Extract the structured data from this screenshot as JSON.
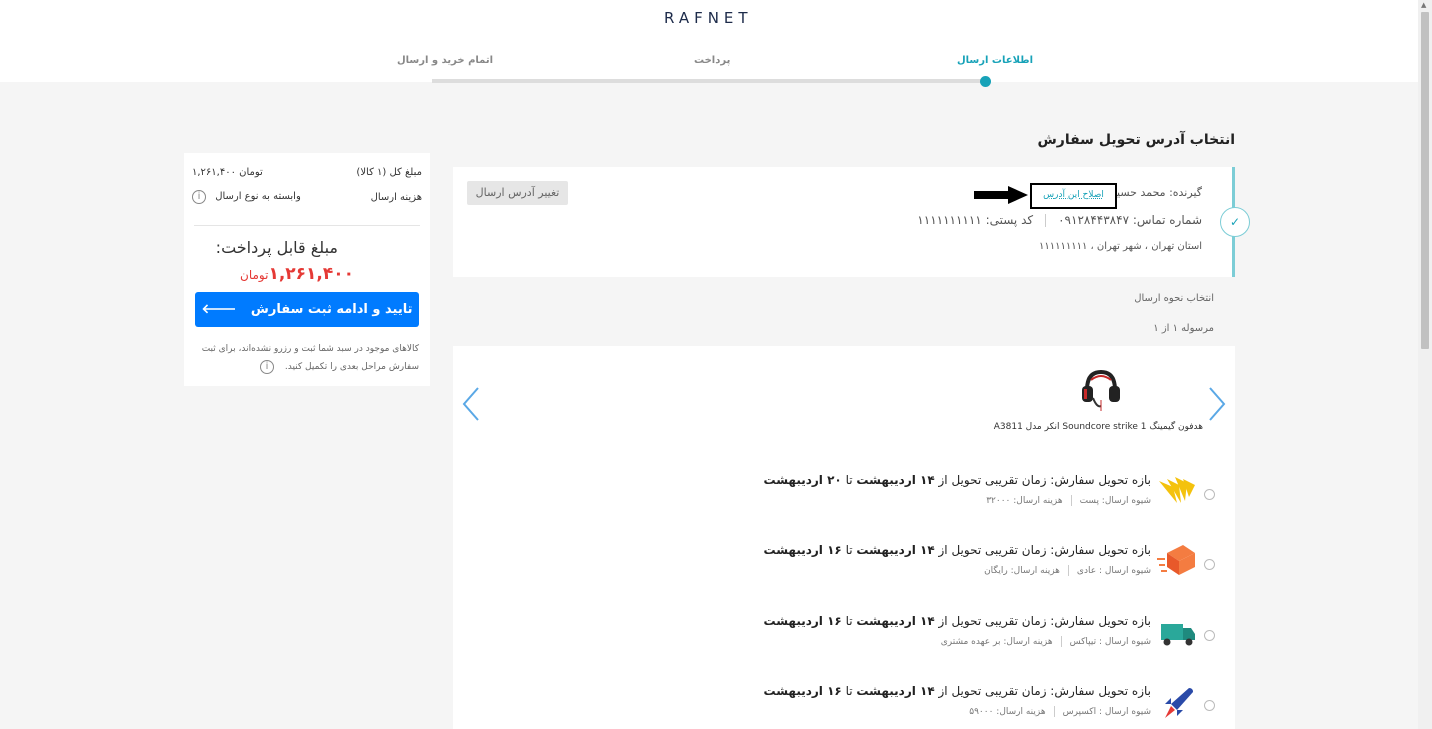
{
  "header": {
    "logo": "RAFNET",
    "steps": [
      "اطلاعات ارسال",
      "پرداخت",
      "اتمام خرید و ارسال"
    ]
  },
  "address": {
    "section_title": "انتخاب آدرس تحویل سفارش",
    "recipient": "گیرنده: محمد حسین",
    "fix_label": "اصلاح این آدرس",
    "phone": "شماره تماس: ۰۹۱۲۸۴۴۳۸۴۷",
    "postal": "کد پستی: ۱۱۱۱۱۱۱۱۱۱",
    "full_address": "استان تهران ، شهر تهران ، ۱۱۱۱۱۱۱۱۱",
    "change_label": "تغییر آدرس ارسال"
  },
  "shipping": {
    "method_title": "انتخاب نحوه ارسال",
    "parcel_title": "مرسوله ۱ از ۱",
    "product_name": "هدفون گیمینگ Soundcore strike 1 انکر مدل A3811",
    "options": [
      {
        "prefix": "بازه تحویل سفارش: زمان تقریبی تحویل از",
        "from": "۱۴ اردیبهشت",
        "to_word": "تا",
        "to": "۲۰ اردیبهشت",
        "method": "شیوه ارسال: پست",
        "cost": "هزینه ارسال: ۳۲۰۰۰",
        "icon": "post-icon"
      },
      {
        "prefix": "بازه تحویل سفارش: زمان تقریبی تحویل از",
        "from": "۱۴ اردیبهشت",
        "to_word": "تا",
        "to": "۱۶ اردیبهشت",
        "method": "شیوه ارسال : عادی",
        "cost": "هزینه ارسال: رایگان",
        "icon": "box-icon"
      },
      {
        "prefix": "بازه تحویل سفارش: زمان تقریبی تحویل از",
        "from": "۱۴ اردیبهشت",
        "to_word": "تا",
        "to": "۱۶ اردیبهشت",
        "method": "شیوه ارسال : تیپاکس",
        "cost": "هزینه ارسال: بر عهده مشتری",
        "icon": "truck-icon"
      },
      {
        "prefix": "بازه تحویل سفارش: زمان تقریبی تحویل از",
        "from": "۱۴ اردیبهشت",
        "to_word": "تا",
        "to": "۱۶ اردیبهشت",
        "method": "شیوه ارسال : اکسپرس",
        "cost": "هزینه ارسال: ۵۹۰۰۰",
        "icon": "rocket-icon"
      }
    ]
  },
  "summary": {
    "total_label": "مبلغ کل (۱ کالا)",
    "total_value": "۱,۲۶۱,۴۰۰ تومان",
    "shipping_label": "هزینه ارسال",
    "shipping_value": "وابسته به نوع ارسال",
    "payable_label": "مبلغ قابل پرداخت:",
    "payable_amount": "۱,۲۶۱,۴۰۰",
    "payable_unit": "تومان",
    "confirm_label": "تایید و ادامه ثبت سفارش",
    "note": "کالاهای موجود در سبد شما ثبت و رزرو نشده‌اند، برای ثبت سفارش مراحل بعدی را تکمیل کنید."
  },
  "colors": {
    "accent": "#17a2b8",
    "primary": "#007bff",
    "price": "#e53935"
  }
}
